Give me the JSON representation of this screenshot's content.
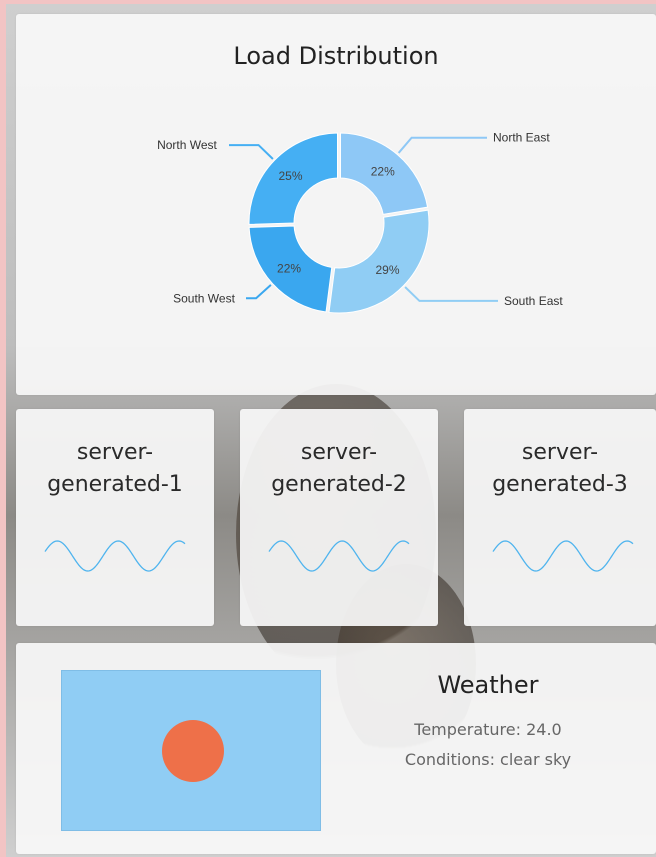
{
  "load": {
    "title": "Load Distribution",
    "chart_data": {
      "type": "pie",
      "variant": "donut",
      "slices": [
        {
          "label": "North East",
          "value": 22,
          "display": "22%",
          "color": "#8ec8f6"
        },
        {
          "label": "South East",
          "value": 29,
          "display": "29%",
          "color": "#90cdf4"
        },
        {
          "label": "South West",
          "value": 22,
          "display": "22%",
          "color": "#3aa7ef"
        },
        {
          "label": "North West",
          "value": 25,
          "display": "25%",
          "color": "#45aff3"
        }
      ]
    }
  },
  "servers": [
    {
      "name_line1": "server-",
      "name_line2": "generated-1"
    },
    {
      "name_line1": "server-",
      "name_line2": "generated-2"
    },
    {
      "name_line1": "server-",
      "name_line2": "generated-3"
    }
  ],
  "weather": {
    "title": "Weather",
    "temperature": "Temperature: 24.0",
    "conditions": "Conditions: clear sky"
  },
  "colors": {
    "wave": "#4fb4ee",
    "sky": "#90cdf4",
    "sun": "#ee7049"
  }
}
